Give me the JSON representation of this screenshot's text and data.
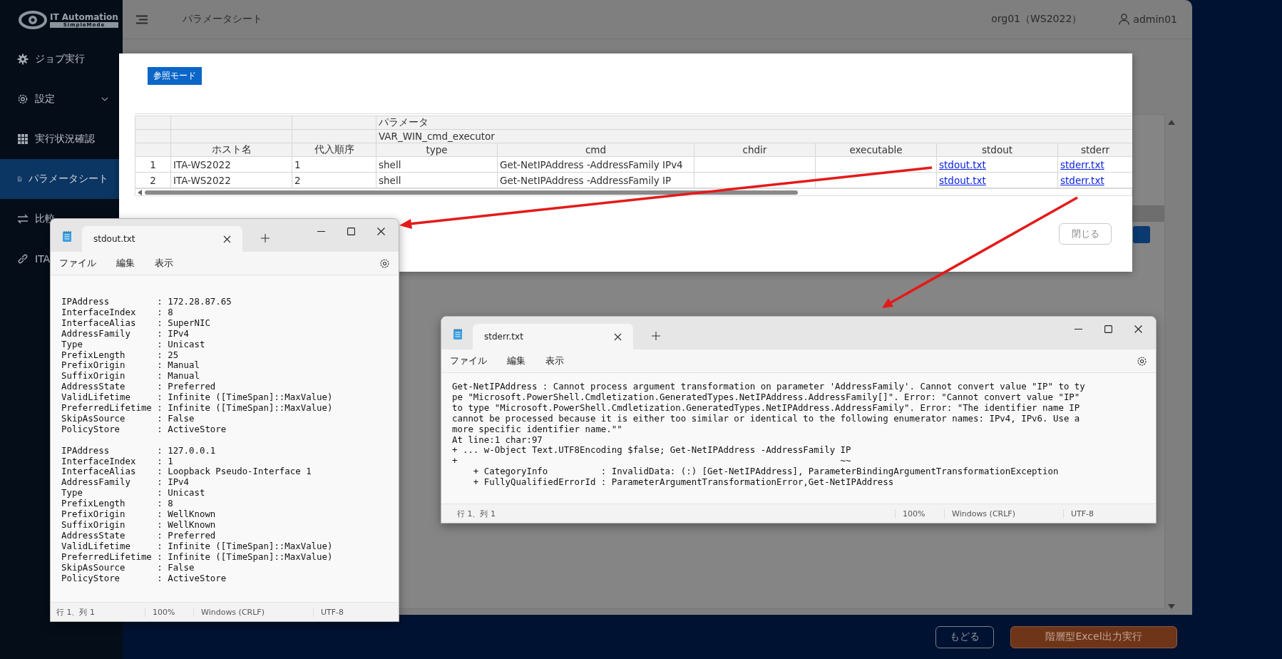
{
  "sidebar": {
    "logo": {
      "title": "IT Automation",
      "subtitle": "SimpleMode"
    },
    "items": [
      {
        "label": "ジョブ実行",
        "kind": "gear",
        "selected": false,
        "expandable": false
      },
      {
        "label": "設定",
        "kind": "cog",
        "selected": false,
        "expandable": true
      },
      {
        "label": "実行状況確認",
        "kind": "grid",
        "selected": false,
        "expandable": false
      },
      {
        "label": "パラメータシート",
        "kind": "document",
        "selected": true,
        "expandable": false
      },
      {
        "label": "比較",
        "kind": "compare",
        "selected": false,
        "expandable": false
      },
      {
        "label": "ITA",
        "kind": "link",
        "selected": false,
        "expandable": false
      }
    ]
  },
  "header": {
    "page_title": "パラメータシート",
    "workspace": "org01（WS2022）",
    "user": "admin01"
  },
  "modal": {
    "mode_badge": "参照モード",
    "table": {
      "group_header": "パラメータ",
      "subgroup_header": "VAR_WIN_cmd_executor",
      "columns": [
        "",
        "ホスト名",
        "代入順序",
        "type",
        "cmd",
        "chdir",
        "executable",
        "stdout",
        "stderr"
      ],
      "rows": [
        {
          "cells": [
            {
              "kind": "number",
              "text": "1"
            },
            {
              "kind": "text",
              "text": "ITA-WS2022"
            },
            {
              "kind": "text",
              "text": "1"
            },
            {
              "kind": "text",
              "text": "shell"
            },
            {
              "kind": "text",
              "text": "Get-NetIPAddress -AddressFamily IPv4"
            },
            {
              "kind": "empty"
            },
            {
              "kind": "empty"
            },
            {
              "kind": "link",
              "text": "stdout.txt"
            },
            {
              "kind": "link",
              "text": "stderr.txt"
            }
          ]
        },
        {
          "cells": [
            {
              "kind": "number",
              "text": "2"
            },
            {
              "kind": "text",
              "text": "ITA-WS2022"
            },
            {
              "kind": "text",
              "text": "2"
            },
            {
              "kind": "text",
              "text": "shell"
            },
            {
              "kind": "text",
              "text": "Get-NetIPAddress -AddressFamily IP"
            },
            {
              "kind": "empty"
            },
            {
              "kind": "empty"
            },
            {
              "kind": "link",
              "text": "stdout.txt"
            },
            {
              "kind": "link",
              "text": "stderr.txt"
            }
          ]
        }
      ]
    },
    "close_button": "閉じる"
  },
  "windows": [
    {
      "kind": "stdout",
      "tab_title": "stdout.txt",
      "menu": [
        "ファイル",
        "編集",
        "表示"
      ],
      "blocks": [
        [
          "IPAddress         : 172.28.87.65",
          "InterfaceIndex    : 8",
          "InterfaceAlias    : SuperNIC",
          "AddressFamily     : IPv4",
          "Type              : Unicast",
          "PrefixLength      : 25",
          "PrefixOrigin      : Manual",
          "SuffixOrigin      : Manual",
          "AddressState      : Preferred",
          "ValidLifetime     : Infinite ([TimeSpan]::MaxValue)",
          "PreferredLifetime : Infinite ([TimeSpan]::MaxValue)",
          "SkipAsSource      : False",
          "PolicyStore       : ActiveStore"
        ],
        [
          "IPAddress         : 127.0.0.1",
          "InterfaceIndex    : 1",
          "InterfaceAlias    : Loopback Pseudo-Interface 1",
          "AddressFamily     : IPv4",
          "Type              : Unicast",
          "PrefixLength      : 8",
          "PrefixOrigin      : WellKnown",
          "SuffixOrigin      : WellKnown",
          "AddressState      : Preferred",
          "ValidLifetime     : Infinite ([TimeSpan]::MaxValue)",
          "PreferredLifetime : Infinite ([TimeSpan]::MaxValue)",
          "SkipAsSource      : False",
          "PolicyStore       : ActiveStore"
        ]
      ],
      "status": {
        "position": "行 1、列 1",
        "zoom": "100%",
        "line_ending": "Windows (CRLF)",
        "encoding": "UTF-8"
      }
    },
    {
      "kind": "stderr",
      "tab_title": "stderr.txt",
      "menu": [
        "ファイル",
        "編集",
        "表示"
      ],
      "blocks": [
        [
          "Get-NetIPAddress : Cannot process argument transformation on parameter 'AddressFamily'. Cannot convert value \"IP\" to ty",
          "pe \"Microsoft.PowerShell.Cmdletization.GeneratedTypes.NetIPAddress.AddressFamily[]\". Error: \"Cannot convert value \"IP\"",
          "to type \"Microsoft.PowerShell.Cmdletization.GeneratedTypes.NetIPAddress.AddressFamily\". Error: \"The identifier name IP",
          "cannot be processed because it is either too similar or identical to the following enumerator names: IPv4, IPv6. Use a",
          "more specific identifier name.\"\"",
          "At line:1 char:97",
          "+ ... w-Object Text.UTF8Encoding $false; Get-NetIPAddress -AddressFamily IP",
          "+                                                                        ~~",
          "    + CategoryInfo          : InvalidData: (:) [Get-NetIPAddress], ParameterBindingArgumentTransformationException",
          "    + FullyQualifiedErrorId : ParameterArgumentTransformationError,Get-NetIPAddress"
        ]
      ],
      "status": {
        "position": "行 1、列 1",
        "zoom": "100%",
        "line_ending": "Windows (CRLF)",
        "encoding": "UTF-8"
      }
    }
  ],
  "footer_buttons": [
    {
      "label": "もどる",
      "kind": "secondary"
    },
    {
      "label": "階層型Excel出力実行",
      "kind": "primary"
    }
  ]
}
